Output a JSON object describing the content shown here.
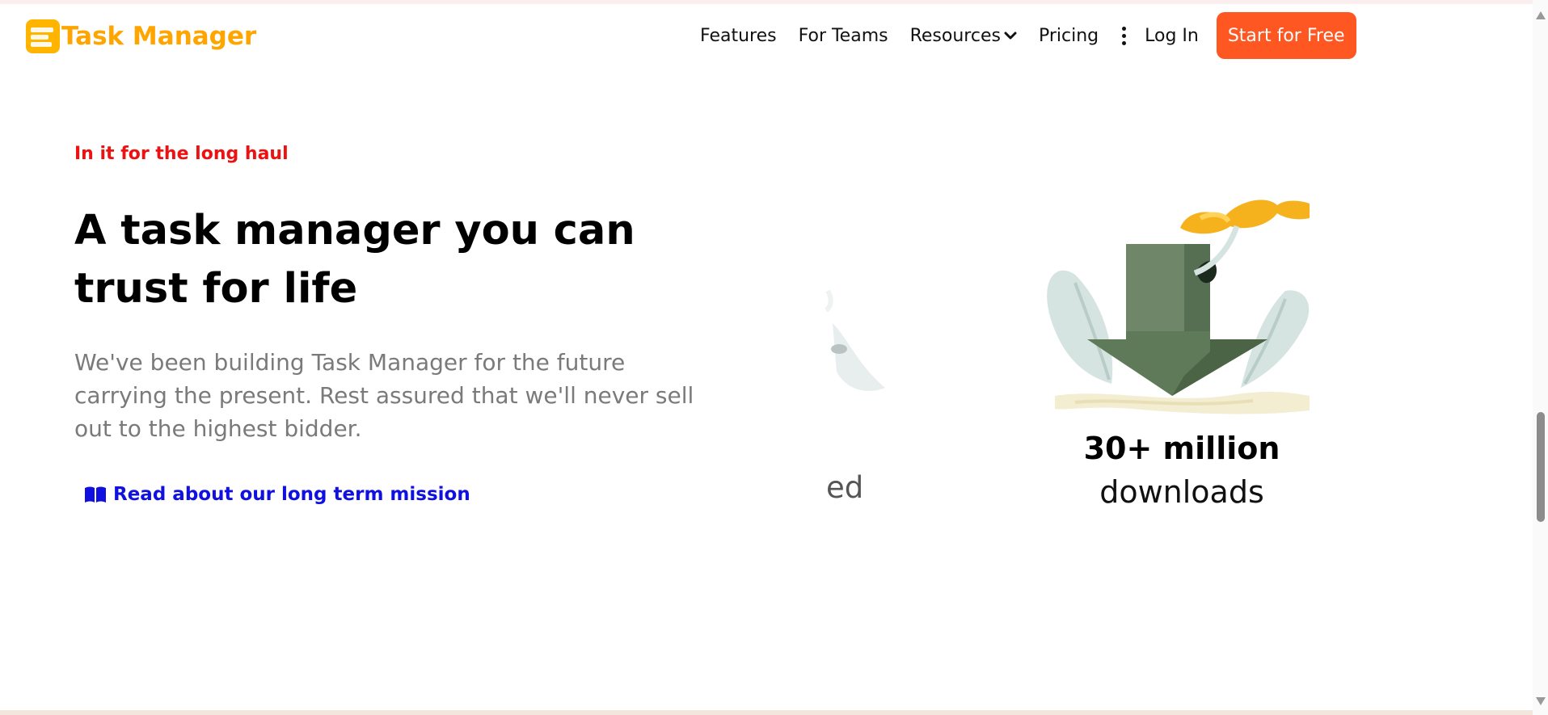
{
  "brand": {
    "name": "Task Manager",
    "color": "#ffa500"
  },
  "nav": {
    "items": [
      "Features",
      "For Teams",
      "Resources",
      "Pricing"
    ],
    "more_icon": "kebab-menu-icon",
    "login": "Log In",
    "cta": "Start for Free",
    "cta_color": "#ff5722"
  },
  "hero": {
    "eyebrow": "In it for the long haul",
    "title": "A task manager you can trust for life",
    "description": "We've been building Task Manager for the future carrying the present. Rest assured that we'll never sell out to the highest bidder.",
    "link": "Read about our long term mission",
    "link_icon": "book-open-icon"
  },
  "stats": {
    "partial_text": "ed",
    "strong": "30+ million",
    "label": "downloads",
    "illustration": "download-arrow-illustration"
  }
}
